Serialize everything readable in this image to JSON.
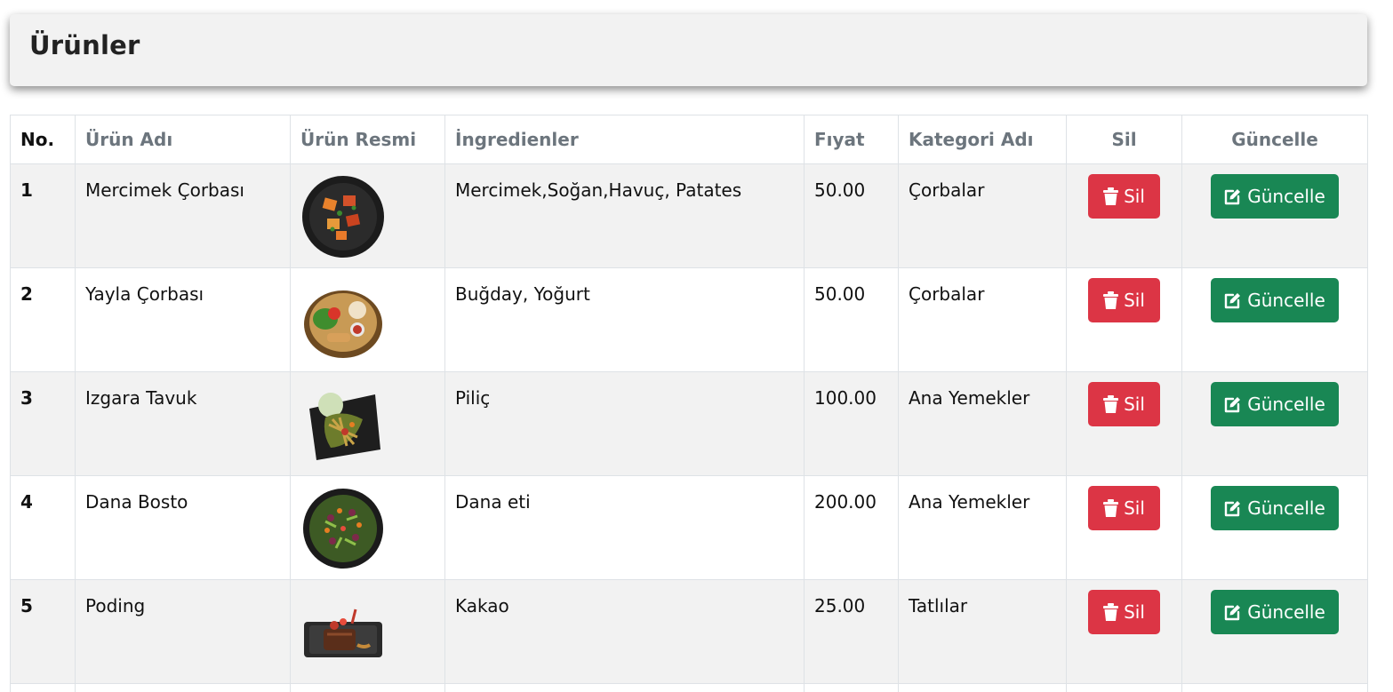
{
  "header": {
    "title": "Ürünler"
  },
  "table": {
    "columns": {
      "no": "No.",
      "name": "Ürün Adı",
      "image": "Ürün Resmi",
      "ingredients": "İngredienler",
      "price": "Fıyat",
      "category": "Kategori Adı",
      "delete": "Sil",
      "update": "Güncelle"
    },
    "rows": [
      {
        "no": "1",
        "name": "Mercimek Çorbası",
        "ingredients": "Mercimek,Soğan,Havuç, Patates",
        "price": "50.00",
        "category": "Çorbalar",
        "image_icon": "food-photo-icon"
      },
      {
        "no": "2",
        "name": "Yayla Çorbası",
        "ingredients": "Buğday, Yoğurt",
        "price": "50.00",
        "category": "Çorbalar",
        "image_icon": "food-photo-icon"
      },
      {
        "no": "3",
        "name": "Izgara Tavuk",
        "ingredients": "Piliç",
        "price": "100.00",
        "category": "Ana Yemekler",
        "image_icon": "food-photo-icon"
      },
      {
        "no": "4",
        "name": "Dana Bosto",
        "ingredients": "Dana eti",
        "price": "200.00",
        "category": "Ana Yemekler",
        "image_icon": "food-photo-icon"
      },
      {
        "no": "5",
        "name": "Poding",
        "ingredients": "Kakao",
        "price": "25.00",
        "category": "Tatlılar",
        "image_icon": "food-photo-icon"
      }
    ]
  },
  "buttons": {
    "delete_label": "Sil",
    "update_label": "Güncelle",
    "delete_icon": "trash-icon",
    "update_icon": "edit-icon"
  },
  "colors": {
    "danger": "#dc3545",
    "success": "#198754",
    "stripe": "#f2f2f2",
    "header_muted": "#6c757d"
  }
}
